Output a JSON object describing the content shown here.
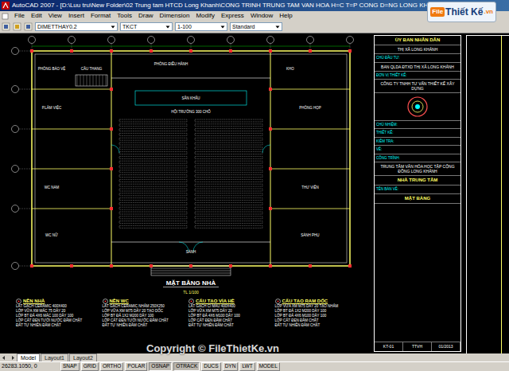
{
  "window": {
    "title": "AutoCAD 2007 - [D:\\Luu tru\\New Folder\\02 Trung tam HTCD Long Khanh\\CONG TRINH TRUNG TAM VAN HOA H=C T=P CONG D=NG LONG KHANH.dwg]"
  },
  "logo": {
    "prefix": "File",
    "main": "Thiết Kế",
    "suffix": ".vn"
  },
  "menu": [
    "File",
    "Edit",
    "View",
    "Insert",
    "Format",
    "Tools",
    "Draw",
    "Dimension",
    "Modify",
    "Express",
    "Window",
    "Help"
  ],
  "toolbar": {
    "dropdowns": [
      "DIMETTHAY0.2",
      "TKCT",
      "1-100",
      "Standard"
    ]
  },
  "plan": {
    "title": "MẶT BẰNG NHÀ",
    "scale": "TL 1/100",
    "rooms": [
      "CẦU THANG",
      "PHÒNG BẢO VỆ",
      "P.LÀM VIỆC",
      "PHÒNG ĐIỀU HÀNH",
      "SẢNH",
      "KHO",
      "HỘI TRƯỜNG 300 CHỖ",
      "SÂN KHẤU",
      "WC NAM",
      "WC NỮ",
      "PHÒNG HỌP",
      "THƯ VIỆN",
      "SẢNH PHỤ"
    ]
  },
  "notes": [
    {
      "title": "NỀN NHÀ",
      "lines": [
        "LÁT GẠCH CERAMIC 400X400",
        "LỚP VỮA XM MÁC 75 DÀY 20",
        "LỚP BT ĐÁ 4X6 MÁC 100 DÀY 100",
        "LỚP CÁT ĐEN TƯỚI NƯỚC ĐẦM CHẶT",
        "ĐẤT TỰ NHIÊN ĐẦM CHẶT"
      ]
    },
    {
      "title": "NỀN WC",
      "lines": [
        "LÁT GẠCH CERAMIC NHÁM 250X250",
        "LỚP VỮA XM M75 DÀY 20 TẠO DỐC",
        "LỚP BT ĐÁ 1X2 M200 DÀY 100",
        "LỚP CÁT ĐEN TƯỚI NƯỚC ĐẦM CHẶT",
        "ĐẤT TỰ NHIÊN ĐẦM CHẶT"
      ]
    },
    {
      "title": "CẤU TẠO VỈA HÈ",
      "lines": [
        "LÁT GẠCH CÍ MÀU 400X400",
        "LỚP VỮA XM M75 DÀY 20",
        "LỚP BT ĐÁ 4X6 M100 DÀY 100",
        "LỚP CÁT ĐEN ĐẦM CHẶT",
        "ĐẤT TỰ NHIÊN ĐẦM CHẶT"
      ]
    },
    {
      "title": "CẤU TẠO RAM DỐC",
      "lines": [
        "LỚP VỮA XM M75 DÀY 20 TẠO NHÁM",
        "LỚP BT ĐÁ 1X2 M200 DÀY 100",
        "LỚP BT ĐÁ 4X6 M100 DÀY 100",
        "LỚP CÁT ĐEN ĐẦM CHẶT",
        "ĐẤT TỰ NHIÊN ĐẦM CHẶT"
      ]
    }
  ],
  "titleBlock": {
    "entries": [
      {
        "kind": "heading",
        "text": "ỦY BAN NHÂN DÂN"
      },
      {
        "kind": "value",
        "text": "THỊ XÃ LONG KHÁNH"
      },
      {
        "kind": "label",
        "text": "CHỦ ĐẦU TƯ:"
      },
      {
        "kind": "value",
        "text": "BAN QLDA ĐTXD THỊ XÃ LONG KHÁNH"
      },
      {
        "kind": "label",
        "text": "ĐƠN VỊ THIẾT KẾ:"
      },
      {
        "kind": "value",
        "text": "CÔNG TY TNHH TƯ VẤN THIẾT KẾ XÂY DỰNG"
      },
      {
        "kind": "logo",
        "text": ""
      },
      {
        "kind": "label",
        "text": "CHỦ NHIỆM:"
      },
      {
        "kind": "label",
        "text": "THIẾT KẾ:"
      },
      {
        "kind": "label",
        "text": "KIỂM TRA:"
      },
      {
        "kind": "label",
        "text": "VẼ:"
      },
      {
        "kind": "label",
        "text": "CÔNG TRÌNH:"
      },
      {
        "kind": "value",
        "text": "TRUNG TÂM VĂN HÓA HỌC TẬP CỘNG ĐỒNG LONG KHÁNH"
      },
      {
        "kind": "heading",
        "text": "NHÀ TRUNG TÂM"
      },
      {
        "kind": "label",
        "text": "TÊN BẢN VẼ:"
      },
      {
        "kind": "heading",
        "text": "MẶT BẰNG"
      }
    ],
    "sheetInfo": [
      "KT-01",
      "TTVH",
      "01/2013"
    ]
  },
  "layoutTabs": [
    {
      "label": "Model",
      "selected": true
    },
    {
      "label": "Layout1",
      "selected": false
    },
    {
      "label": "Layout2",
      "selected": false
    }
  ],
  "statusBar": {
    "coords": "26283.1050, 0",
    "toggles": [
      {
        "label": "SNAP",
        "on": false
      },
      {
        "label": "GRID",
        "on": false
      },
      {
        "label": "ORTHO",
        "on": false
      },
      {
        "label": "POLAR",
        "on": false
      },
      {
        "label": "OSNAP",
        "on": true
      },
      {
        "label": "OTRACK",
        "on": true
      },
      {
        "label": "DUCS",
        "on": false
      },
      {
        "label": "DYN",
        "on": false
      },
      {
        "label": "LWT",
        "on": false
      },
      {
        "label": "MODEL",
        "on": false
      }
    ]
  },
  "watermark": "Copyright © FileThietKe.vn"
}
